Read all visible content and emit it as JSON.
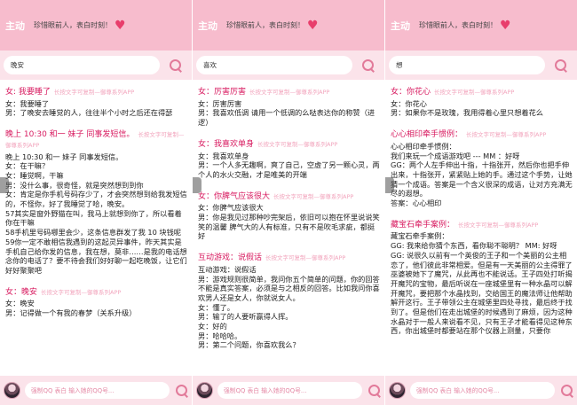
{
  "header": {
    "title": "主动",
    "slogan": "珍惜眼前人，表白时刻！"
  },
  "panels": [
    {
      "search_value": "晚安",
      "qq_placeholder": "强制QQ 表白 输入她的QQ号...",
      "entries": [
        {
          "title": "女: 我要睡了",
          "sub": "长按文字可复制—御尊系列APP",
          "lines": [
            "女：我要睡了",
            "男：了晚安去睡觉的人，往往半个小时之后还在得瑟"
          ]
        },
        {
          "title": "晚上 10:30 和一 妹子 同事发短信。",
          "sub": "长按文字可复制—御尊系列APP",
          "lines": [
            "晚上 10:30 和一 妹子 同事发短信。",
            "女：在干嘛？",
            "女：睡觉啊，干嘛",
            "男：没什么事，很奇怪，就是突然想到到你",
            "女：肯定是你手机号码存少了，才会突然想到给我发短信的，不怪你，好了我睡觉了哈，晚安。",
            "57其实是窗外野猫在叫，我马上就想到你了，所以看着你在干嘛",
            "58手机里号码哪里会少，这条信息群发了我 10 块钱呢",
            "59你一定不敢相信我遇到的这起灵异事件，昨天其实是手机自己给你发的信息，我在想，莫非……是我的电话想念你的电话了？要不待会我们好好聊一起吃晚饭，让它们好好聚聚吧"
          ]
        },
        {
          "title": "女：晚安",
          "sub": "长按文字可复制—御尊系列APP",
          "lines": [
            "女：晚安",
            "男：记得做一个有我的春梦（关系升级）"
          ]
        }
      ],
      "peek": "女：晚安   \\"
    },
    {
      "search_value": "喜欢",
      "qq_placeholder": "强制QQ 表白 输入她的QQ号...",
      "entries": [
        {
          "title": "女：厉害厉害",
          "sub": "长按文字可复制—御尊系列APP",
          "lines": [
            "女：厉害厉害",
            "男：我喜欢低调 请用一个低调的么哒表达你的称赞（进逻）"
          ]
        },
        {
          "title": "女：我喜欢单身",
          "sub": "长按文字可复制—御尊系列APP",
          "lines": [
            "女：我喜欢单身",
            "男：一个人多无趣啊，爽了自己，空虚了另一颗心灵，两个人的水火交融，才是唯美的开端"
          ]
        },
        {
          "title": "女：你脾气应该很大",
          "sub": "长按文字可复制—御尊系列APP",
          "lines": [
            "女：你脾气应该很大",
            "男：你是我见过那种吵完架后，依旧可以抱在怀里说说笑笑的温馨 脾气大的人有标准，只有不是吹毛求疵，都挺好"
          ]
        },
        {
          "title": "互动游戏：说假话",
          "sub": "长按文字可复制—御尊系列APP",
          "lines": [
            "互动游戏：说假话",
            "男：游戏规则很简单，我问你五个简单的问题，你的回答不能是真实答案，必须是与之相反的回答。比如我问你喜欢男人还是女人，你就说女人。",
            "女：懂了。",
            "男：输了的人要听赢得人挥。",
            "女：好的",
            "男：哈哈哈。",
            "男：第二个问题，你喜欢我么？"
          ]
        }
      ],
      "peek": ""
    },
    {
      "search_value": "想",
      "qq_placeholder": "强制QQ 表白 输入她的QQ号...",
      "entries": [
        {
          "title": "女：你花心",
          "sub": "长按文字可复制—御尊系列APP",
          "lines": [
            "女：你花心",
            "男：如果你不是玫瑰，我用得着心里只想着花么"
          ]
        },
        {
          "title": "心心相印牵手惯例：",
          "sub": "长按文字可复制—御尊系列APP",
          "lines": [
            "心心相印牵手惯例：",
            "我们来玩一个成语游戏吧 --- MM ：好呀",
            "GG：两个人左手伸出十指，十指张开，然后你也把手伸出来，十指张开，紧紧贴上她的手。通过这个手势，让她猜一个成语。答案是一个含义很深的成语，让对方充满无尽的遐想。",
            "答案：心心相印"
          ]
        },
        {
          "title": "藏宝石牵手案例：",
          "sub": "长按文字可复制—御尊系列APP",
          "lines": [
            "藏宝石牵手案例：",
            "GG: 我来给你猜个东西，看你聪不聪明？ MM: 好呀",
            "GG: 说很久以前有一个英俊的王子和一个美丽的公主相恋了，他们彼此非常相爱。但是有一天美丽的公主得罪了巫婆被她下了魔咒，从此再也不能说话。王子四处打听揭开魔咒的宝物，最后听说在一座城堡里有一种水晶可以解开魔咒，要把那个水晶找到，交给国王的魔法师让他帮助解开这行。王子带领公主在城堡里四处寻找，最后终于找到了。但是他们在走出城堡的时候遇到了麻烦，因为这种水晶对于一般人来说看不见，只有王子才能看得见这种东西，你出城堡时都要站在那个仪器上测量，只要你"
          ]
        }
      ],
      "peek": ""
    }
  ]
}
